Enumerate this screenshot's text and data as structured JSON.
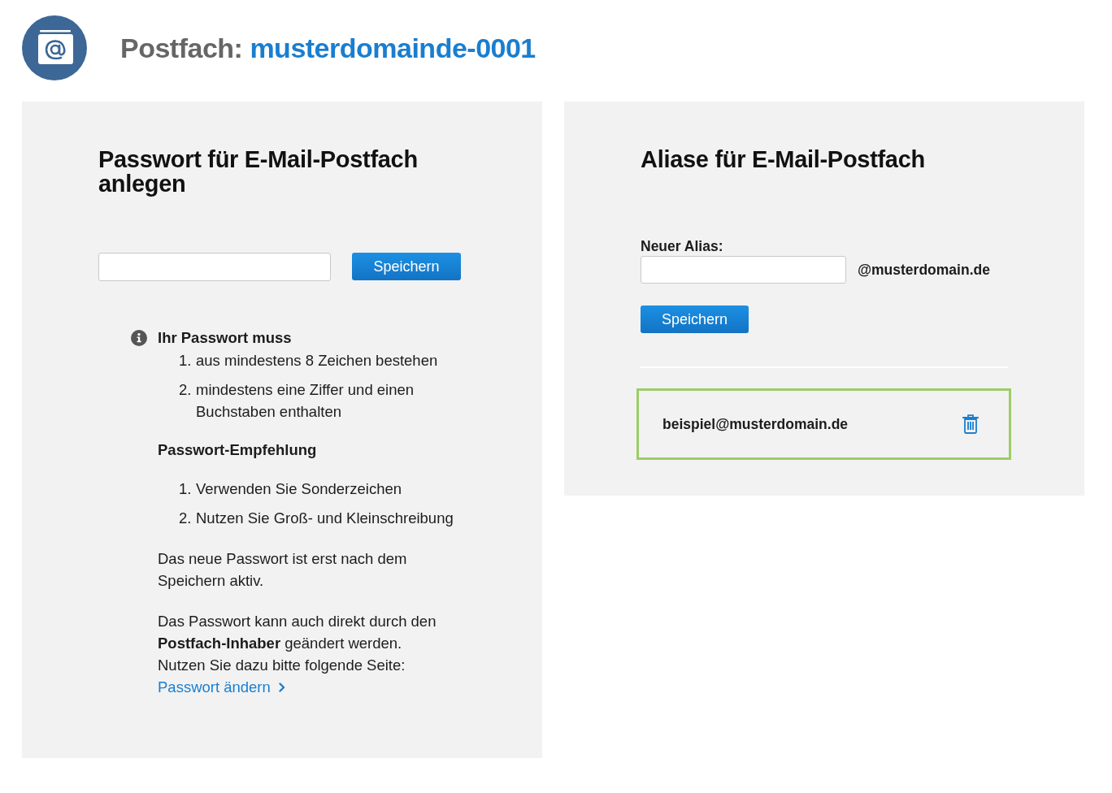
{
  "header": {
    "label": "Postfach:",
    "mailbox": "musterdomainde-0001"
  },
  "password_panel": {
    "title": "Passwort für E-Mail-Postfach anlegen",
    "save_button": "Speichern",
    "requirements": {
      "heading": "Ihr Passwort muss",
      "items": [
        {
          "number": "1.",
          "text": "aus mindestens 8 Zeichen bestehen"
        },
        {
          "number": "2.",
          "text": "mindestens eine Ziffer und einen Buchstaben enthalten"
        }
      ]
    },
    "recommendation": {
      "heading": "Passwort-Empfehlung",
      "items": [
        {
          "number": "1.",
          "text": "Verwenden Sie Sonderzeichen"
        },
        {
          "number": "2.",
          "text": "Nutzen Sie Groß- und Kleinschreibung"
        }
      ]
    },
    "notes": [
      {
        "lines": [
          "Das neue Passwort ist erst nach dem Speichern aktiv."
        ]
      },
      {
        "lines": [
          "Das Passwort kann auch direkt durch den **Postfach-Inhaber** geändert werden.",
          "Nutzen Sie dazu bitte folgende Seite:"
        ]
      }
    ],
    "link": "Passwort ändern"
  },
  "alias_panel": {
    "title": "Aliase für E-Mail-Postfach",
    "new_alias_label": "Neuer Alias:",
    "domain_suffix": "@musterdomain.de",
    "save_button": "Speichern",
    "aliases": [
      {
        "address": "beispiel@musterdomain.de",
        "highlighted": true
      }
    ]
  }
}
